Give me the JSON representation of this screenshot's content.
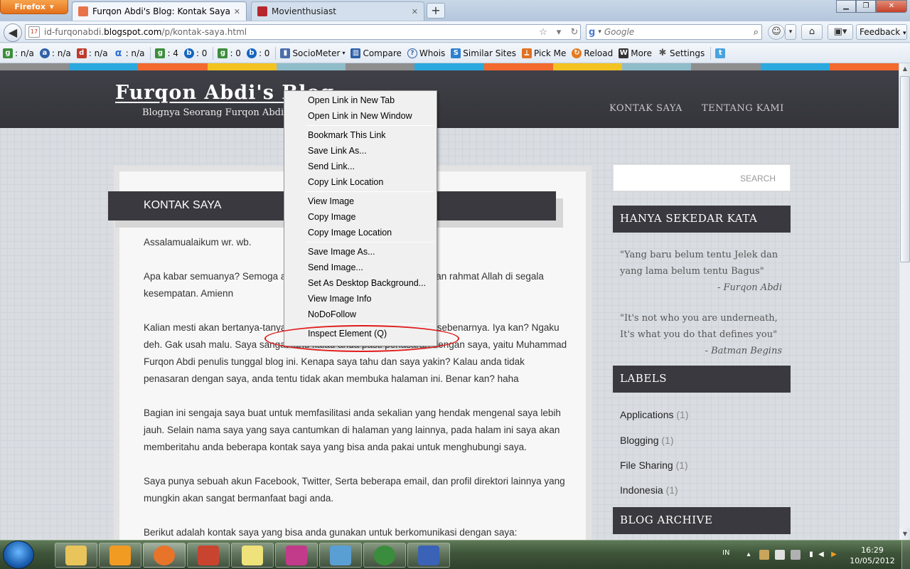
{
  "browser": {
    "menu_button": "Firefox",
    "tabs": [
      {
        "title": "Furqon Abdi's Blog: Kontak Saya",
        "favicon_color": "#e8734a"
      },
      {
        "title": "Movienthusiast",
        "favicon_color": "#b6262d"
      }
    ],
    "url": {
      "prefix": "id-furqonabdi.",
      "host": "blogspot.com",
      "path": "/p/kontak-saya.html"
    },
    "search_placeholder": "Google",
    "feedback_label": "Feedback"
  },
  "bookmarks": [
    {
      "label": ": n/a",
      "color": "#3c8d3c",
      "icon": "pagerank-icon"
    },
    {
      "label": ": n/a",
      "color": "#2f5fa8",
      "icon": "alexa-icon"
    },
    {
      "label": ": n/a",
      "color": "#c0392b",
      "icon": "dmoz-icon"
    },
    {
      "label": ": n/a",
      "color": "#2f6fd1",
      "icon": "alpha-icon"
    },
    {
      "label": ": 4",
      "color": "#3c8d3c",
      "icon": "google-index-icon"
    },
    {
      "label": ": 0",
      "color": "#1565c0",
      "icon": "bing-icon"
    },
    {
      "label": ": 0",
      "color": "#3c8d3c",
      "icon": "google-links-icon"
    },
    {
      "label": ": 0",
      "color": "#1565c0",
      "icon": "bing-links-icon"
    },
    {
      "label": "SocioMeter",
      "color": "#4a6ea8",
      "icon": "sociometer-icon"
    },
    {
      "label": "Compare",
      "color": "#2b5fa8",
      "icon": "compare-icon"
    },
    {
      "label": "Whois",
      "color": "#2b5fa8",
      "icon": "whois-icon"
    },
    {
      "label": "Similar Sites",
      "color": "#2f7fd0",
      "icon": "similar-sites-icon"
    },
    {
      "label": "Pick Me",
      "color": "#e07020",
      "icon": "pickme-icon"
    },
    {
      "label": "Reload",
      "color": "#e57a1f",
      "icon": "reload-icon"
    },
    {
      "label": "More",
      "color": "#333333",
      "icon": "more-icon"
    },
    {
      "label": "Settings",
      "color": "#777777",
      "icon": "settings-icon"
    },
    {
      "label": "",
      "color": "#4aa3df",
      "icon": "twitter-icon"
    }
  ],
  "stripe_colors": [
    "#8e8e8e",
    "#2aa9df",
    "#f26a2e",
    "#f3c321",
    "#8fbcc9",
    "#8e8e8e",
    "#2aa9df",
    "#f26a2e",
    "#f3c321",
    "#8fbcc9",
    "#8e8e8e",
    "#2aa9df",
    "#f26a2e"
  ],
  "blog": {
    "title": "Furqon Abdi's Blog",
    "description": "Blognya Seorang Furqon Abdi",
    "nav": [
      "KONTAK SAYA",
      "TENTANG KAMI"
    ]
  },
  "post": {
    "title": "KONTAK SAYA",
    "paragraphs": [
      "Assalamualaikum wr. wb.",
      "Apa kabar semuanya? Semoga anda semua dalam keadaan sehat dan rahmat Allah di segala kesempatan. Amienn",
      "Kalian mesti akan bertanya-tanya kenapa saya bisa tahu siapa anda sebenarnya. Iya kan? Ngaku deh. Gak usah malu. Saya sangat tahu kalau anda pasti penasaran dengan saya, yaitu Muhammad Furqon Abdi penulis tunggal blog ini. Kenapa saya tahu dan saya yakin? Kalau anda tidak penasaran dengan saya, anda tentu tidak akan membuka halaman ini. Benar kan? haha",
      "Bagian ini sengaja saya buat untuk memfasilitasi anda sekalian yang hendak mengenal saya lebih jauh. Selain nama saya yang saya cantumkan di halaman yang lainnya, pada halam ini saya akan memberitahu anda beberapa kontak saya yang bisa anda pakai untuk menghubungi saya.",
      "Saya punya sebuah akun Facebook, Twitter, Serta beberapa email, dan profil direktori lainnya yang mungkin akan sangat bermanfaat bagi anda.",
      "Berikut adalah kontak saya yang bisa anda gunakan untuk berkomunikasi dengan saya:"
    ]
  },
  "sidebar": {
    "search_label": "SEARCH",
    "quote_title": "HANYA SEKEDAR KATA",
    "quotes": [
      {
        "text": "\"Yang baru belum tentu Jelek dan yang lama belum tentu Bagus\"",
        "author": "- Furqon Abdi"
      },
      {
        "text": "\"It's not who you are underneath, It's what you do that defines you\"",
        "author": "- Batman Begins"
      }
    ],
    "labels_title": "LABELS",
    "labels": [
      {
        "name": "Applications",
        "count": "(1)"
      },
      {
        "name": "Blogging",
        "count": "(1)"
      },
      {
        "name": "File Sharing",
        "count": "(1)"
      },
      {
        "name": "Indonesia",
        "count": "(1)"
      }
    ],
    "archive_title": "BLOG ARCHIVE"
  },
  "context_menu": {
    "groups": [
      [
        "Open Link in New Tab",
        "Open Link in New Window"
      ],
      [
        "Bookmark This Link",
        "Save Link As...",
        "Send Link...",
        "Copy Link Location"
      ],
      [
        "View Image",
        "Copy Image",
        "Copy Image Location"
      ],
      [
        "Save Image As...",
        "Send Image...",
        "Set As Desktop Background...",
        "View Image Info",
        "NoDoFollow"
      ],
      [
        "Inspect Element (Q)"
      ]
    ],
    "highlight_color": "#e11a1a"
  },
  "taskbar": {
    "apps": [
      {
        "name": "explorer",
        "color": "#e8c45a",
        "icon": "folder-icon"
      },
      {
        "name": "media-player",
        "color": "#f29b22",
        "icon": "media-player-icon"
      },
      {
        "name": "firefox",
        "color": "#e8742a",
        "icon": "firefox-icon"
      },
      {
        "name": "ebook-reader",
        "color": "#c9442f",
        "icon": "book-icon"
      },
      {
        "name": "sticky-notes",
        "color": "#f0e27a",
        "icon": "notes-icon"
      },
      {
        "name": "paint-app",
        "color": "#c23a8a",
        "icon": "paint-icon"
      },
      {
        "name": "photo-viewer",
        "color": "#5a9fd4",
        "icon": "photo-icon"
      },
      {
        "name": "chrome",
        "color": "#3a8d3d",
        "icon": "chrome-icon"
      },
      {
        "name": "drawing-app",
        "color": "#3a62b6",
        "icon": "drawing-icon"
      }
    ],
    "language": "IN",
    "time": "16:29",
    "date": "10/05/2012"
  }
}
